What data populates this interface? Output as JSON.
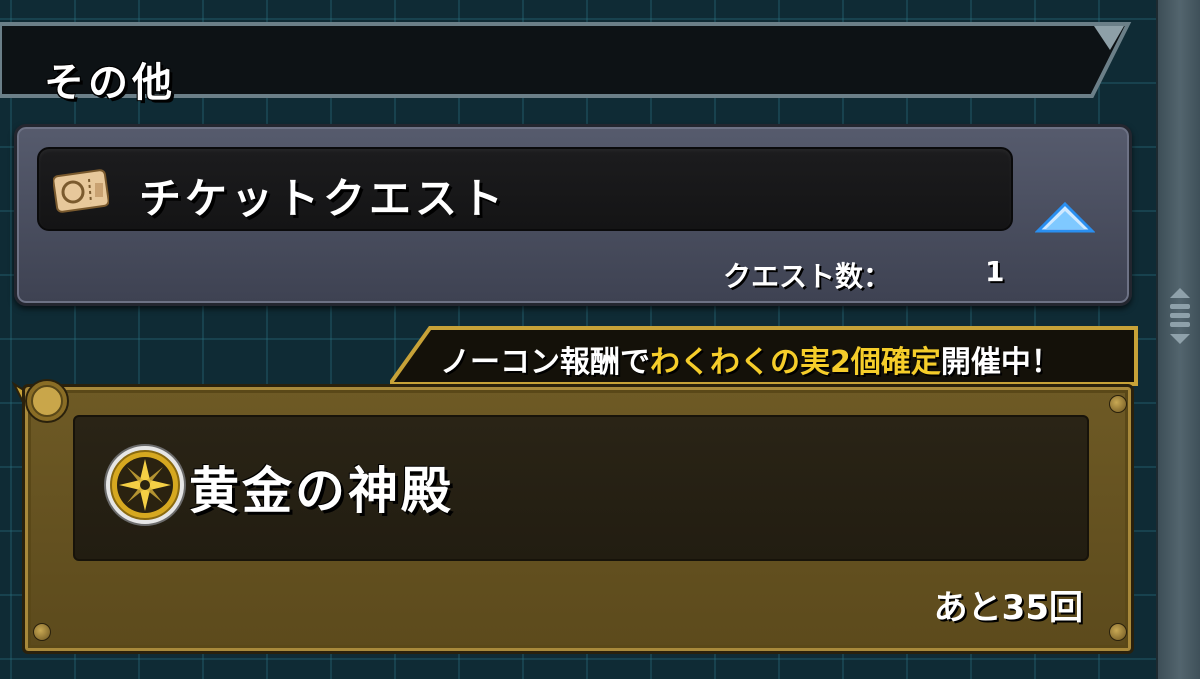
{
  "section": {
    "title": "その他"
  },
  "ticket_quest": {
    "icon": "ticket-icon",
    "label": "チケットクエスト",
    "toggle_icon": "triangle-up-icon",
    "count_label": "クエスト数：",
    "count_value": "1"
  },
  "golden_quest": {
    "event_banner": {
      "prefix": "ノーコン報酬で",
      "highlight": "わくわくの実2個確定",
      "suffix": "開催中！"
    },
    "medal_icon": "gold-compass-medal-icon",
    "title": "黄金の神殿",
    "remaining": "あと35回"
  },
  "colors": {
    "highlight": "#f5cd2a",
    "gold_panel": "#6e5a25",
    "ticket_panel": "#4b4f5f",
    "toggle": "#3ba8ff"
  }
}
